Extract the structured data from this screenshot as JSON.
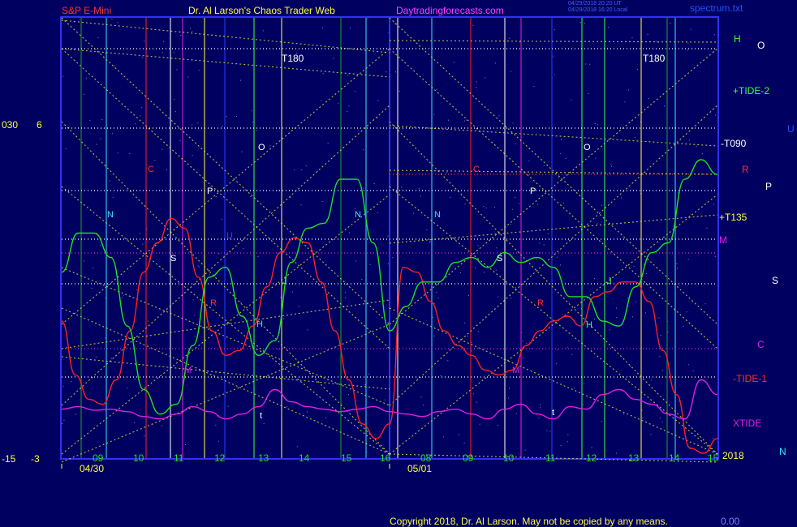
{
  "header": {
    "instrument": "S&P E-Mini",
    "site": "Dr. Al Larson's Chaos Trader Web",
    "url": "Daytradingforecasts.com",
    "stamp1": "04/29/2018 20:20 UT",
    "stamp2": "04/29/2018 16:20 Local",
    "file": "spectrum.txt"
  },
  "footer": {
    "copyright": "Copyright 2018, Dr. Al Larson. May not be copied by any means.",
    "code": "0.00"
  },
  "colors": {
    "background": "#000060",
    "frame": "#3030ff",
    "red_line": "#ff2020",
    "green_line": "#20e020",
    "magenta_line": "#e020e0",
    "yellow_grid": "#e8e840",
    "cyan": "#40e0ff",
    "white": "#ffffff"
  },
  "chart_data": {
    "type": "line",
    "title": "Dr. Al Larson's Chaos Trader Web",
    "y_left_labels": [
      {
        "a": "030",
        "b": "6"
      },
      {
        "a": "-15",
        "b": "-3"
      }
    ],
    "dates": [
      "04/30",
      "05/01"
    ],
    "hour_ticks": [
      [
        "09",
        "10",
        "11",
        "12",
        "13",
        "14",
        "15",
        "16"
      ],
      [
        "08",
        "09",
        "10",
        "11",
        "12",
        "13",
        "14",
        "15"
      ]
    ],
    "right_labels": [
      "H",
      "O",
      "+TIDE-2",
      "U",
      "-T090",
      "R",
      "P",
      "+T135",
      "M",
      "S",
      "C",
      "-TIDE-1",
      "XTIDE",
      "N"
    ],
    "right_year": "2018",
    "inner_labels": {
      "t180": "T180",
      "letters": [
        "N",
        "C",
        "P",
        "O",
        "S",
        "U",
        "R",
        "H",
        "J",
        "M",
        "N",
        "C",
        "P",
        "O",
        "S",
        "R",
        "H",
        "J",
        "M",
        "N",
        "t",
        "t"
      ]
    },
    "series": [
      {
        "name": "-TIDE-1",
        "color": "red",
        "values": [
          -0.2,
          -1.3,
          -1.8,
          -1.9,
          -1.4,
          -0.4,
          0.8,
          1.4,
          1.9,
          1.7,
          0.7,
          -0.4,
          -0.9,
          -0.8,
          -0.3,
          0.5,
          1.2,
          1.5,
          1.4,
          0.6,
          -0.4,
          -1.4,
          -2.3,
          -2.6,
          -2.3,
          0.9,
          0.8,
          0.2,
          -0.4,
          -0.7,
          -0.9,
          -1.2,
          -1.3,
          -1.2,
          -0.7,
          -0.4,
          -0.2,
          -0.1,
          -0.3,
          0.3,
          0.4,
          0.6,
          0.6,
          0.2,
          -0.8,
          -1.7,
          -2.8,
          -2.9,
          -2.6
        ]
      },
      {
        "name": "+TIDE-2",
        "color": "green",
        "values": [
          0.8,
          1.6,
          1.6,
          1.1,
          -0.3,
          -1.6,
          -2.1,
          -1.9,
          -0.7,
          0.7,
          0.9,
          -0.1,
          -0.9,
          -0.6,
          1.0,
          1.7,
          1.8,
          2.7,
          2.7,
          1.4,
          -0.4,
          0.1,
          0.6,
          0.6,
          1.0,
          1.1,
          0.9,
          1.2,
          1.0,
          1.1,
          0.9,
          0.3,
          0.3,
          -0.2,
          -0.3,
          0.5,
          1.2,
          1.4,
          2.7,
          3.1,
          2.8
        ]
      },
      {
        "name": "XTIDE",
        "color": "magenta",
        "values": [
          -2.0,
          -1.95,
          -2.02,
          -2.0,
          -2.05,
          -2.15,
          -2.2,
          -2.1,
          -1.95,
          -2.05,
          -2.2,
          -2.1,
          -1.95,
          -1.6,
          -1.85,
          -1.95,
          -2.0,
          -2.05,
          -2.0,
          -1.95,
          -2.05,
          -2.1,
          -2.15,
          -2.05,
          -2.0,
          -2.1,
          -2.2,
          -2.0,
          -1.9,
          -2.1,
          -2.2,
          -1.95,
          -2.0,
          -1.7,
          -1.6,
          -1.8,
          -1.9,
          -2.1,
          -2.2,
          -1.4,
          -1.7
        ]
      }
    ],
    "xlim": [
      0,
      1
    ],
    "ylim": [
      -3,
      6
    ],
    "grid": true
  }
}
